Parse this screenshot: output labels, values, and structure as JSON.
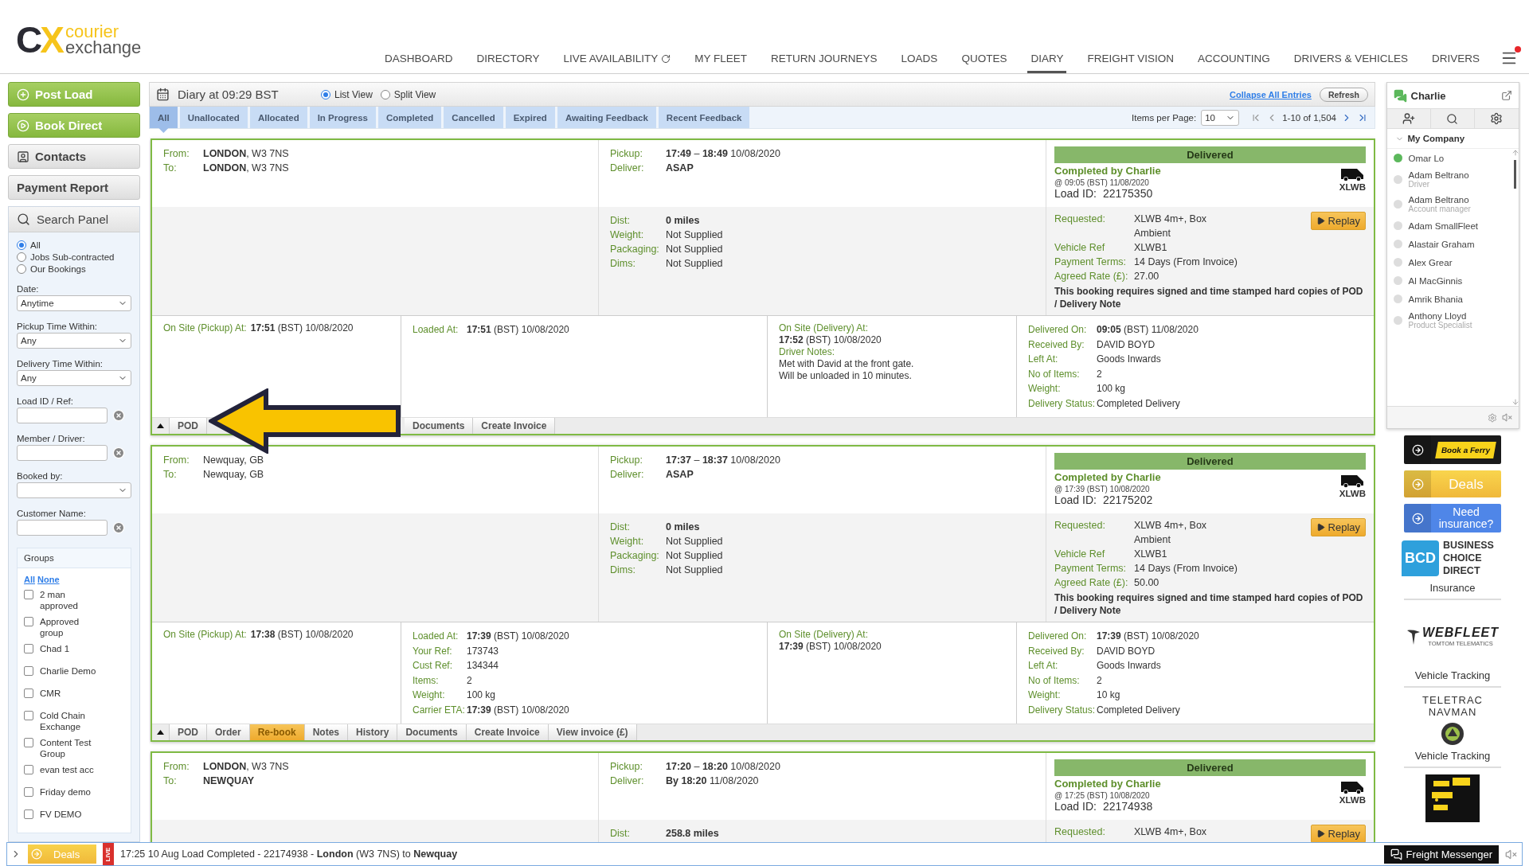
{
  "logo": {
    "mark_left": "C",
    "mark_right": "X",
    "line1": "courier",
    "line2": "exchange"
  },
  "nav": [
    {
      "label": "DASHBOARD",
      "selected": false
    },
    {
      "label": "DIRECTORY",
      "selected": false
    },
    {
      "label": "LIVE AVAILABILITY",
      "selected": false
    },
    {
      "label": "MY FLEET",
      "selected": false
    },
    {
      "label": "RETURN JOURNEYS",
      "selected": false
    },
    {
      "label": "LOADS",
      "selected": false
    },
    {
      "label": "QUOTES",
      "selected": false
    },
    {
      "label": "DIARY",
      "selected": true
    },
    {
      "label": "FREIGHT VISION",
      "selected": false
    },
    {
      "label": "ACCOUNTING",
      "selected": false
    },
    {
      "label": "DRIVERS & VEHICLES",
      "selected": false
    },
    {
      "label": "DRIVERS",
      "selected": false
    }
  ],
  "menu": {
    "notification": true
  },
  "sidebar": {
    "actions": [
      {
        "label": "Post Load",
        "kind": "primary"
      },
      {
        "label": "Book Direct",
        "kind": "primary"
      },
      {
        "label": "Contacts",
        "kind": "secondary"
      },
      {
        "label": "Payment Report",
        "kind": "secondary"
      }
    ],
    "search_panel": {
      "title": "Search Panel",
      "scope": [
        {
          "label": "All",
          "selected": true
        },
        {
          "label": "Jobs Sub-contracted",
          "selected": false
        },
        {
          "label": "Our Bookings",
          "selected": false
        }
      ],
      "filters": [
        {
          "kind": "select",
          "label": "Date:",
          "value": "Anytime"
        },
        {
          "kind": "select",
          "label": "Pickup Time Within:",
          "value": "Any"
        },
        {
          "kind": "select",
          "label": "Delivery Time Within:",
          "value": "Any"
        },
        {
          "kind": "text",
          "label": "Load ID / Ref:"
        },
        {
          "kind": "text",
          "label": "Member / Driver:"
        },
        {
          "kind": "select",
          "label": "Booked by:"
        },
        {
          "kind": "text",
          "label": "Customer Name:"
        }
      ],
      "groups": {
        "title": "Groups",
        "links": [
          "All",
          "None"
        ],
        "items": [
          {
            "label": "2 man approved",
            "checked": false
          },
          {
            "label": "Approved group",
            "checked": false
          },
          {
            "label": "Chad 1",
            "checked": false
          },
          {
            "label": "Charlie Demo",
            "checked": false
          },
          {
            "label": "CMR",
            "checked": false
          },
          {
            "label": "Cold Chain Exchange",
            "checked": false
          },
          {
            "label": "Content Test Group",
            "checked": false
          },
          {
            "label": "evan test acc",
            "checked": false
          },
          {
            "label": "Friday demo",
            "checked": false
          },
          {
            "label": "FV DEMO",
            "checked": false
          }
        ]
      }
    }
  },
  "diary": {
    "title": "Diary at 09:29 BST",
    "views": [
      {
        "label": "List View",
        "selected": true
      },
      {
        "label": "Split View",
        "selected": false
      }
    ],
    "collapse_link": "Collapse All Entries",
    "refresh_button": "Refresh",
    "tabs": [
      {
        "label": "All",
        "selected": true
      },
      {
        "label": "Unallocated",
        "selected": false
      },
      {
        "label": "Allocated",
        "selected": false
      },
      {
        "label": "In Progress",
        "selected": false
      },
      {
        "label": "Completed",
        "selected": false
      },
      {
        "label": "Cancelled",
        "selected": false
      },
      {
        "label": "Expired",
        "selected": false
      },
      {
        "label": "Awaiting Feedback",
        "selected": false
      },
      {
        "label": "Recent Feedback",
        "selected": false
      }
    ],
    "pager": {
      "label": "Items per Page:",
      "per_page": "10",
      "range": "1-10 of 1,504"
    },
    "cards": [
      {
        "arrow_annotation": true,
        "status": "Delivered",
        "completed_by": "Completed by Charlie",
        "completed_at": "@ 09:05 (BST) 11/08/2020",
        "load_id_label": "Load ID:",
        "load_id": "22175350",
        "vehicle": "XLWB",
        "route": [
          {
            "label": "From:",
            "value": "**LONDON**, W3 7NS"
          },
          {
            "label": "To:",
            "value": "**LONDON**, W3 7NS"
          }
        ],
        "timing": [
          {
            "label": "Pickup:",
            "value": "**17:49** – **18:49** 10/08/2020"
          },
          {
            "label": "Deliver:",
            "value": "ASAP",
            "bold": true
          }
        ],
        "load": [
          {
            "label": "Dist:",
            "value": "0 miles",
            "bold": true
          },
          {
            "label": "Weight:",
            "value": "Not Supplied"
          },
          {
            "label": "Packaging:",
            "value": "Not Supplied"
          },
          {
            "label": "Dims:",
            "value": "Not Supplied"
          }
        ],
        "booking": [
          {
            "label": "Requested:",
            "value": "XLWB 4m+, Box\nAmbient"
          },
          {
            "label": "Vehicle Ref",
            "value": "XLWB1"
          },
          {
            "label": "Payment Terms:",
            "value": "14 Days (From Invoice)"
          },
          {
            "label": "Agreed Rate (£):",
            "value": "27.00"
          }
        ],
        "replay": "Replay",
        "notice": "This booking requires signed and time stamped hard copies of POD / Delivery Note",
        "events": [
          {
            "kind": "inline",
            "rows": [
              {
                "label": "On Site (Pickup) At:",
                "value": "**17:51** (BST) 10/08/2020"
              }
            ]
          },
          {
            "kind": "table",
            "rows": [
              {
                "label": "Loaded At:",
                "value": "**17:51** (BST) 10/08/2020"
              }
            ]
          },
          {
            "kind": "stacked",
            "rows": [
              {
                "label": "On Site (Delivery) At:",
                "value": "**17:52** (BST) 10/08/2020"
              },
              {
                "label": "Driver Notes:",
                "value": "Met with David at the front gate. Will be unloaded in 10 minutes."
              }
            ]
          },
          {
            "kind": "table",
            "rows": [
              {
                "label": "Delivered On:",
                "value": "**09:05** (BST) 11/08/2020"
              },
              {
                "label": "Received By:",
                "value": "DAVID BOYD"
              },
              {
                "label": "Left At:",
                "value": "Goods Inwards"
              },
              {
                "label": "No of Items:",
                "value": "2"
              },
              {
                "label": "Weight:",
                "value": "100 kg"
              },
              {
                "label": "Delivery Status:",
                "value": "Completed Delivery"
              }
            ]
          }
        ],
        "actions": [
          {
            "label": "POD",
            "highlighted": false
          },
          {
            "label": "Documents",
            "highlighted": false
          },
          {
            "label": "Create Invoice",
            "highlighted": false
          }
        ]
      },
      {
        "arrow_annotation": false,
        "status": "Delivered",
        "completed_by": "Completed by Charlie",
        "completed_at": "@ 17:39 (BST) 10/08/2020",
        "load_id_label": "Load ID:",
        "load_id": "22175202",
        "vehicle": "XLWB",
        "route": [
          {
            "label": "From:",
            "value": "Newquay, GB"
          },
          {
            "label": "To:",
            "value": "Newquay, GB"
          }
        ],
        "timing": [
          {
            "label": "Pickup:",
            "value": "**17:37** – **18:37** 10/08/2020"
          },
          {
            "label": "Deliver:",
            "value": "ASAP",
            "bold": true
          }
        ],
        "load": [
          {
            "label": "Dist:",
            "value": "0 miles",
            "bold": true
          },
          {
            "label": "Weight:",
            "value": "Not Supplied"
          },
          {
            "label": "Packaging:",
            "value": "Not Supplied"
          },
          {
            "label": "Dims:",
            "value": "Not Supplied"
          }
        ],
        "booking": [
          {
            "label": "Requested:",
            "value": "XLWB 4m+, Box\nAmbient"
          },
          {
            "label": "Vehicle Ref",
            "value": "XLWB1"
          },
          {
            "label": "Payment Terms:",
            "value": "14 Days (From Invoice)"
          },
          {
            "label": "Agreed Rate (£):",
            "value": "50.00"
          }
        ],
        "replay": "Replay",
        "notice": "This booking requires signed and time stamped hard copies of POD / Delivery Note",
        "events": [
          {
            "kind": "inline",
            "rows": [
              {
                "label": "On Site (Pickup) At:",
                "value": "**17:38** (BST) 10/08/2020"
              }
            ]
          },
          {
            "kind": "table",
            "rows": [
              {
                "label": "Loaded At:",
                "value": "**17:39** (BST) 10/08/2020"
              },
              {
                "label": "Your Ref:",
                "value": "173743"
              },
              {
                "label": "Cust Ref:",
                "value": "134344"
              },
              {
                "label": "Items:",
                "value": "2"
              },
              {
                "label": "Weight:",
                "value": "100 kg"
              },
              {
                "label": "Carrier ETA:",
                "value": "**17:39** (BST) 10/08/2020"
              }
            ]
          },
          {
            "kind": "stacked",
            "rows": [
              {
                "label": "On Site (Delivery) At:",
                "value": "**17:39** (BST) 10/08/2020"
              }
            ]
          },
          {
            "kind": "table",
            "rows": [
              {
                "label": "Delivered On:",
                "value": "**17:39** (BST) 10/08/2020"
              },
              {
                "label": "Received By:",
                "value": "DAVID BOYD"
              },
              {
                "label": "Left At:",
                "value": "Goods Inwards"
              },
              {
                "label": "No of Items:",
                "value": "2"
              },
              {
                "label": "Weight:",
                "value": "10 kg"
              },
              {
                "label": "Delivery Status:",
                "value": "Completed Delivery"
              }
            ]
          }
        ],
        "actions": [
          {
            "label": "POD",
            "highlighted": false
          },
          {
            "label": "Order",
            "highlighted": false
          },
          {
            "label": "Re-book",
            "highlighted": true
          },
          {
            "label": "Notes",
            "highlighted": false
          },
          {
            "label": "History",
            "highlighted": false
          },
          {
            "label": "Documents",
            "highlighted": false
          },
          {
            "label": "Create Invoice",
            "highlighted": false
          },
          {
            "label": "View invoice (£)",
            "highlighted": false
          }
        ]
      },
      {
        "arrow_annotation": false,
        "status": "Delivered",
        "completed_by": "Completed by Charlie",
        "completed_at": "@ 17:25 (BST) 10/08/2020",
        "load_id_label": "Load ID:",
        "load_id": "22174938",
        "vehicle": "XLWB",
        "route": [
          {
            "label": "From:",
            "value": "**LONDON**, W3 7NS"
          },
          {
            "label": "To:",
            "value": "NEWQUAY",
            "bold": true
          }
        ],
        "timing": [
          {
            "label": "Pickup:",
            "value": "**17:20** – **18:20** 10/08/2020"
          },
          {
            "label": "Deliver:",
            "value": "**By 18:20** 11/08/2020"
          }
        ],
        "load": [
          {
            "label": "Dist:",
            "value": "258.8 miles",
            "bold": true
          }
        ],
        "booking": [
          {
            "label": "Requested:",
            "value": "XLWB 4m+, Box"
          }
        ],
        "replay": "Replay"
      }
    ]
  },
  "chat": {
    "title": "Charlie",
    "group": {
      "label": "My Company",
      "expanded": true
    },
    "contacts": [
      {
        "name": "Omar Lo",
        "online": true
      },
      {
        "name": "Adam Beltrano",
        "role": "Driver",
        "online": false
      },
      {
        "name": "Adam Beltrano",
        "role": "Account manager",
        "online": false
      },
      {
        "name": "Adam SmallFleet",
        "online": false
      },
      {
        "name": "Alastair Graham",
        "online": false
      },
      {
        "name": "Alex Grear",
        "online": false
      },
      {
        "name": "Al MacGinnis",
        "online": false
      },
      {
        "name": "Amrik Bhania",
        "online": false
      },
      {
        "name": "Anthony Lloyd",
        "role": "Product Specialist",
        "online": false
      }
    ]
  },
  "ads": [
    {
      "kind": "ferry",
      "label": "Book a Ferry"
    },
    {
      "kind": "deals",
      "label": "Deals"
    },
    {
      "kind": "insurance",
      "label": "Need insurance?"
    },
    {
      "kind": "bcd",
      "mark": "BCD",
      "name": "BUSINESS CHOICE DIRECT",
      "caption": "Insurance"
    },
    {
      "kind": "webfleet",
      "name": "WEBFLEET",
      "sub": "TOMTOM TELEMATICS",
      "caption": "Vehicle Tracking"
    },
    {
      "kind": "teletrac",
      "name": "TELETRAC NAVMAN",
      "caption": "Vehicle Tracking"
    },
    {
      "kind": "picture"
    }
  ],
  "bottom_bar": {
    "deals": "Deals",
    "live": "LIVE",
    "ticker": "17:25 10 Aug Load Completed - 22174938 - **London** (W3 7NS) to **Newquay**",
    "messenger": "Freight Messenger"
  }
}
